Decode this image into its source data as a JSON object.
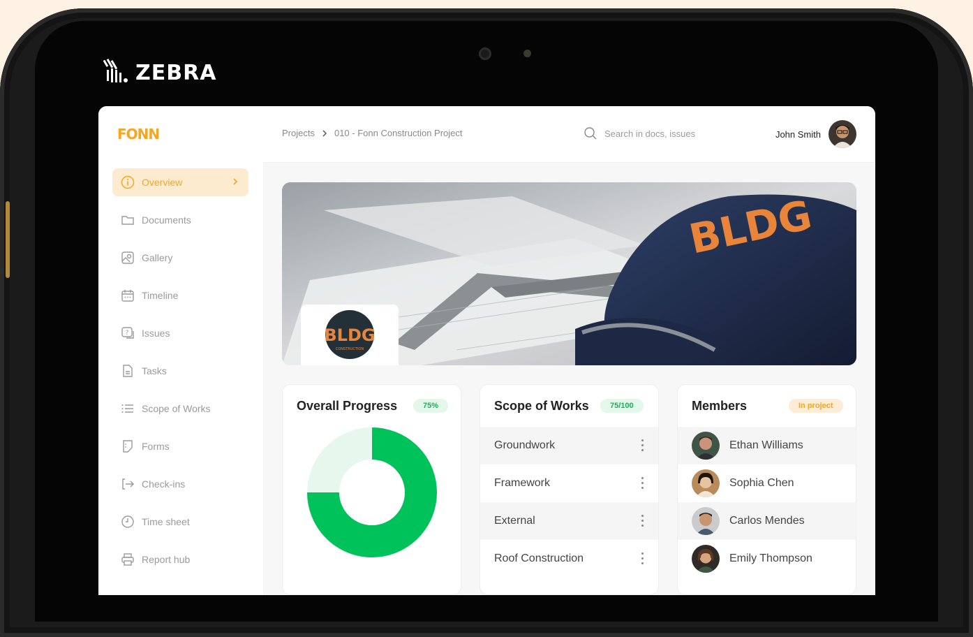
{
  "device": {
    "brand": "ZEBRA"
  },
  "app": {
    "logo": "FONN"
  },
  "breadcrumb": {
    "root": "Projects",
    "current": "010 - Fonn Construction Project"
  },
  "search": {
    "placeholder": "Search in docs, issues"
  },
  "user": {
    "name": "John Smith"
  },
  "sidebar": {
    "items": [
      {
        "label": "Overview",
        "icon": "info-icon",
        "active": true
      },
      {
        "label": "Documents",
        "icon": "folder-icon"
      },
      {
        "label": "Gallery",
        "icon": "image-icon"
      },
      {
        "label": "Timeline",
        "icon": "calendar-icon"
      },
      {
        "label": "Issues",
        "icon": "issue-icon"
      },
      {
        "label": "Tasks",
        "icon": "file-icon"
      },
      {
        "label": "Scope of Works",
        "icon": "list-icon"
      },
      {
        "label": "Forms",
        "icon": "form-icon"
      },
      {
        "label": "Check-ins",
        "icon": "checkin-icon"
      },
      {
        "label": "Time sheet",
        "icon": "clock-icon"
      },
      {
        "label": "Report hub",
        "icon": "printer-icon"
      }
    ]
  },
  "banner": {
    "cap_text": "BLDG",
    "logo_text": "BLDG",
    "logo_sub": "CONSTRUCTION"
  },
  "progress": {
    "title": "Overall Progress",
    "badge": "75%",
    "value": 0.75
  },
  "scope": {
    "title": "Scope of Works",
    "badge": "75/100",
    "items": [
      "Groundwork",
      "Framework",
      "External",
      "Roof Construction"
    ]
  },
  "members": {
    "title": "Members",
    "badge": "In project",
    "items": [
      "Ethan Williams",
      "Sophia Chen",
      "Carlos Mendes",
      "Emily Thompson"
    ]
  },
  "colors": {
    "accent": "#f5a623",
    "success": "#00c25a",
    "success_light": "#e6f7ee"
  }
}
